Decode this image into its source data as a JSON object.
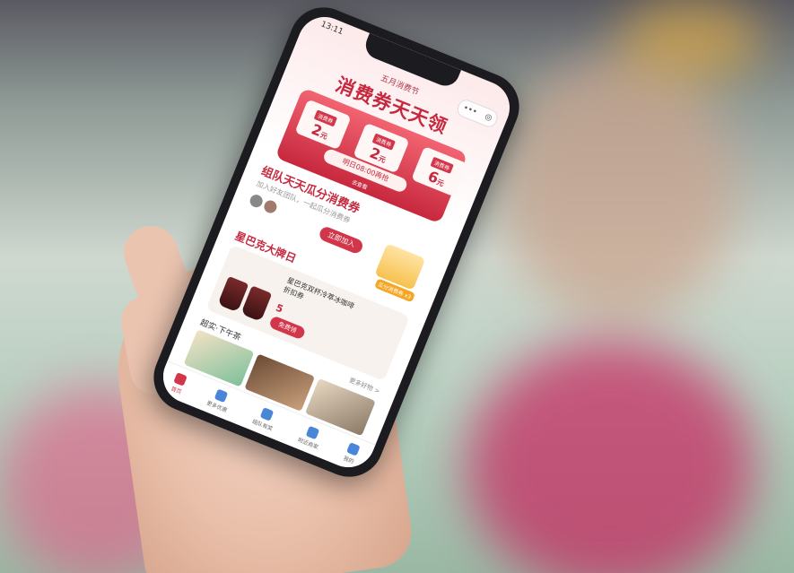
{
  "status": {
    "time": "13:11"
  },
  "capsule": {
    "icon": "ellipsis-icon",
    "close": "◎"
  },
  "banner": {
    "subtitle": "五月消费节",
    "title": "消费券天天领",
    "coupons": [
      {
        "label": "消费券",
        "amount": "2",
        "unit": "元"
      },
      {
        "label": "消费券",
        "amount": "2",
        "unit": "元"
      },
      {
        "label": "消费券",
        "amount": "6",
        "unit": "元"
      }
    ],
    "cta": "明日08:00再抢",
    "hint": "去查看"
  },
  "team": {
    "title": "组队天天瓜分消费券",
    "subtitle": "加入好友团队，一起瓜分消费券",
    "join_button": "立即加入",
    "gift_label": "瓜分消费券 x3"
  },
  "brand": {
    "title": "星巴克大牌日"
  },
  "product": {
    "name": "星巴克双杯冷萃冰咖啡折扣券",
    "price": "5",
    "claim_button": "免费领"
  },
  "section": {
    "title": "超实·下午茶",
    "more": "更多好物 >"
  },
  "tabs": [
    {
      "label": "首页",
      "active": true
    },
    {
      "label": "更多优惠",
      "active": false
    },
    {
      "label": "组队有奖",
      "active": false
    },
    {
      "label": "附近商家",
      "active": false
    },
    {
      "label": "我的",
      "active": false
    }
  ]
}
